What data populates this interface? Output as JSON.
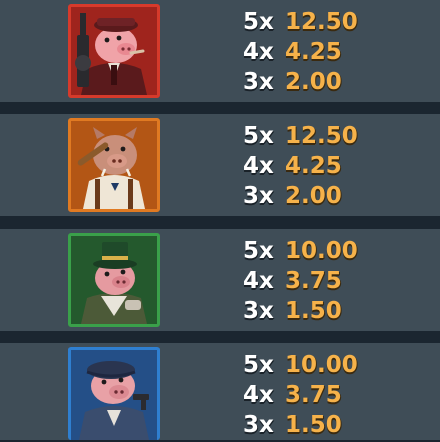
{
  "colors": {
    "background": "#1b2630",
    "panel": "#3f4d57",
    "multiplier_text": "#ffffff",
    "payout_text": "#f6b24a",
    "frame_red": "#d63a2b",
    "frame_orange": "#e07a22",
    "frame_green": "#3aa04a",
    "frame_blue": "#2f7fd0"
  },
  "symbols": [
    {
      "icon": "pig-gangster-tommy-gun-icon",
      "frame_color": "#d63a2b",
      "pays": [
        {
          "count": "5x",
          "payout": "12.50"
        },
        {
          "count": "4x",
          "payout": "4.25"
        },
        {
          "count": "3x",
          "payout": "2.00"
        }
      ]
    },
    {
      "icon": "pig-boss-bat-icon",
      "frame_color": "#e07a22",
      "pays": [
        {
          "count": "5x",
          "payout": "12.50"
        },
        {
          "count": "4x",
          "payout": "4.25"
        },
        {
          "count": "3x",
          "payout": "2.00"
        }
      ]
    },
    {
      "icon": "pig-top-hat-icon",
      "frame_color": "#3aa04a",
      "pays": [
        {
          "count": "5x",
          "payout": "10.00"
        },
        {
          "count": "4x",
          "payout": "3.75"
        },
        {
          "count": "3x",
          "payout": "1.50"
        }
      ]
    },
    {
      "icon": "pig-cap-pistol-icon",
      "frame_color": "#2f7fd0",
      "pays": [
        {
          "count": "5x",
          "payout": "10.00"
        },
        {
          "count": "4x",
          "payout": "3.75"
        },
        {
          "count": "3x",
          "payout": "1.50"
        }
      ]
    }
  ]
}
